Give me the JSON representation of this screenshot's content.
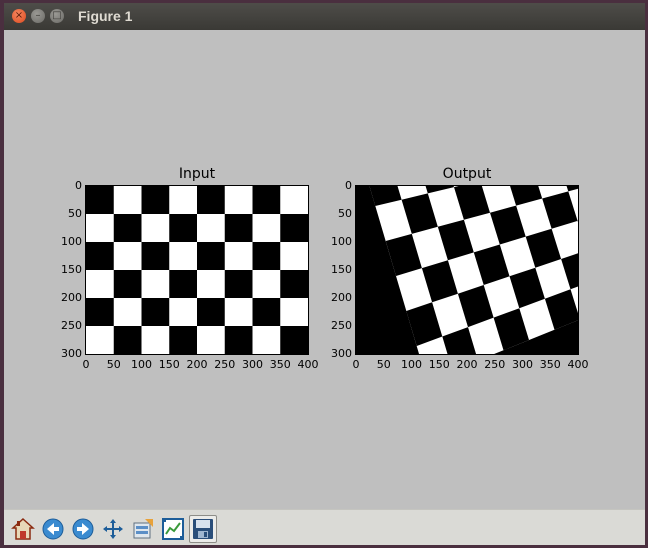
{
  "window": {
    "title": "Figure 1"
  },
  "chart_data": [
    {
      "type": "image",
      "title": "Input",
      "content": "checkerboard 8 columns x 6 rows, alternating black and white squares",
      "xlim": [
        0,
        400
      ],
      "ylim": [
        300,
        0
      ],
      "xticks": [
        "0",
        "50",
        "100",
        "150",
        "200",
        "250",
        "300",
        "350",
        "400"
      ],
      "yticks": [
        "0",
        "50",
        "100",
        "150",
        "200",
        "250",
        "300"
      ]
    },
    {
      "type": "image",
      "title": "Output",
      "content": "perspective-warped checkerboard",
      "xlim": [
        0,
        400
      ],
      "ylim": [
        300,
        0
      ],
      "xticks": [
        "0",
        "50",
        "100",
        "150",
        "200",
        "250",
        "300",
        "350",
        "400"
      ],
      "yticks": [
        "0",
        "50",
        "100",
        "150",
        "200",
        "250",
        "300"
      ]
    }
  ],
  "toolbar": {
    "tools": [
      "home-icon",
      "back-arrow-icon",
      "forward-arrow-icon",
      "pan-icon",
      "configure-subplots-icon",
      "zoom-icon",
      "save-icon"
    ]
  },
  "colors": {
    "canvas_bg": "#bfbfbf",
    "titlebar_bg": "#3c3b37",
    "toolbar_bg": "#dadad6"
  }
}
